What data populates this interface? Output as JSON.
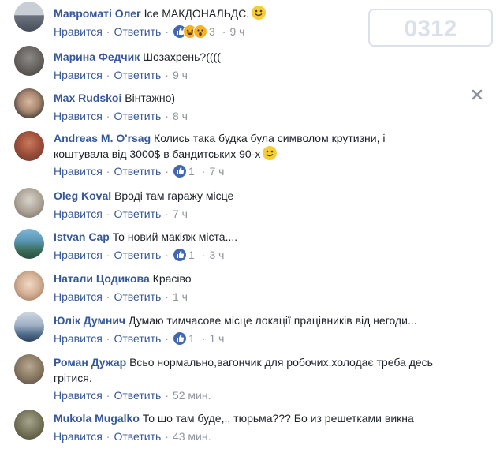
{
  "comments": [
    {
      "author": "Мавроматі Олег",
      "text": "Ісе МАКДОНАЛЬДС.",
      "text2": "",
      "like": "Нравится",
      "reply": "Ответить",
      "reactions": "3",
      "time": "9 ч"
    },
    {
      "author": "Марина Федчик",
      "text": "Шозахрень?((((",
      "text2": "",
      "like": "Нравится",
      "reply": "Ответить",
      "reactions": "",
      "time": "9 ч"
    },
    {
      "author": "Max Rudskoi",
      "text": "Вінтажно)",
      "text2": "",
      "like": "Нравится",
      "reply": "Ответить",
      "reactions": "",
      "time": "8 ч"
    },
    {
      "author": "Andreas M. O'rsag",
      "text": "Колись така будка була символом крутизни, і",
      "text2": "коштувала від 3000$ в бандитських 90-х",
      "like": "Нравится",
      "reply": "Ответить",
      "reactions": "1",
      "time": "7 ч"
    },
    {
      "author": "Oleg Koval",
      "text": "Вроді там гаражу місце",
      "text2": "",
      "like": "Нравится",
      "reply": "Ответить",
      "reactions": "",
      "time": "7 ч"
    },
    {
      "author": "Istvan Cap",
      "text": "То новий макіяж міста....",
      "text2": "",
      "like": "Нравится",
      "reply": "Ответить",
      "reactions": "1",
      "time": "3 ч"
    },
    {
      "author": "Натали Цодикова",
      "text": "Красіво",
      "text2": "",
      "like": "Нравится",
      "reply": "Ответить",
      "reactions": "",
      "time": "1 ч"
    },
    {
      "author": "Юлік Думнич",
      "text": "Думаю тимчасове місце локації працівників від негоди...",
      "text2": "",
      "like": "Нравится",
      "reply": "Ответить",
      "reactions": "1",
      "time": "1 ч"
    },
    {
      "author": "Роман Дужар",
      "text": "Всьо нормально,вагончик для робочих,холодає треба десь",
      "text2": "грітися.",
      "like": "Нравится",
      "reply": "Ответить",
      "reactions": "",
      "time": "52 мин."
    },
    {
      "author": "Mukola Mugalko",
      "text": "То шо там буде,,, тюрьма??? Бо из решетками викна",
      "text2": "",
      "like": "Нравится",
      "reply": "Ответить",
      "reactions": "",
      "time": "43 мин."
    }
  ],
  "watermark": {
    "text": "0312"
  },
  "colors": {
    "author": "#365899",
    "action": "#385898",
    "meta": "#90949c",
    "like_icon": "#4267b2"
  }
}
